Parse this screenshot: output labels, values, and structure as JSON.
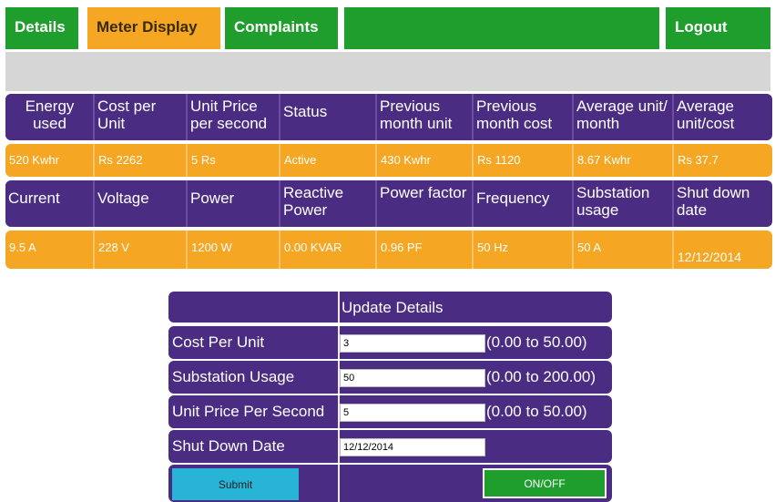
{
  "nav": {
    "details": "Details",
    "meter_display": "Meter Display",
    "complaints": "Complaints",
    "logout": "Logout"
  },
  "row1_headers": [
    "Energy used",
    "Cost per Unit",
    "Unit Price per second",
    "Status",
    "Previous month unit",
    "Previous month cost",
    "Average unit/ month",
    "Average unit/cost"
  ],
  "row1_values": [
    "520 Kwhr",
    "Rs 2262",
    "5 Rs",
    "Active",
    "430 Kwhr",
    "Rs 1120",
    "8.67 Kwhr",
    "Rs 37.7"
  ],
  "row2_headers": [
    "Current",
    "Voltage",
    "Power",
    "Reactive Power",
    "Power factor",
    "Frequency",
    "Substation usage",
    "Shut down date"
  ],
  "row2_values": [
    "9.5 A",
    "228 V",
    "1200 W",
    "0.00 KVAR",
    "0.96 PF",
    "50 Hz",
    "50 A",
    "12/12/2014"
  ],
  "form": {
    "title": "Update Details",
    "cost_per_unit": {
      "label": "Cost Per Unit",
      "value": "3",
      "range": "(0.00 to 50.00)"
    },
    "substation_usage": {
      "label": "Substation Usage",
      "value": "50",
      "range": "(0.00 to 200.00)"
    },
    "unit_price_per_second": {
      "label": "Unit Price Per Second",
      "value": "5",
      "range": "(0.00 to 50.00)"
    },
    "shut_down_date": {
      "label": "Shut Down Date",
      "value": "12/12/2014"
    },
    "submit": "Submit",
    "onoff": "ON/OFF"
  },
  "colors": {
    "green": "#1f9e2e",
    "orange": "#f5a623",
    "purple": "#4b2c83",
    "cyan": "#27b4d6",
    "grey": "#d6d6d6"
  }
}
